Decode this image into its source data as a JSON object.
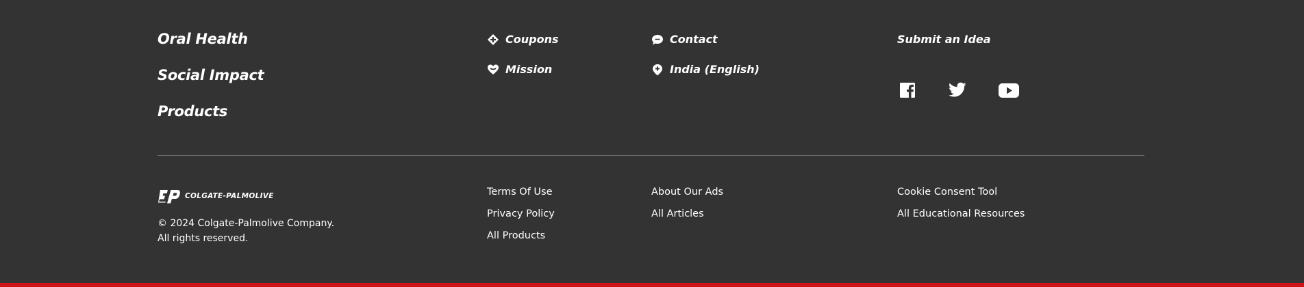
{
  "main_links": [
    "Oral Health",
    "Social Impact",
    "Products"
  ],
  "quick_links": {
    "coupons": "Coupons",
    "mission": "Mission",
    "contact": "Contact",
    "region": "India (English)"
  },
  "submit_idea": "Submit an Idea",
  "social": {
    "facebook_icon": "facebook-icon",
    "twitter_icon": "twitter-icon",
    "youtube_icon": "youtube-icon"
  },
  "brand": {
    "logo_text": "COLGATE-PALMOLIVE",
    "copyright_line1": "© 2024 Colgate-Palmolive Company.",
    "copyright_line2": "All rights reserved."
  },
  "legal_links": {
    "col1": [
      "Terms Of Use",
      "Privacy Policy",
      "All Products"
    ],
    "col2": [
      "About Our Ads",
      "All Articles"
    ],
    "col3": [
      "Cookie Consent Tool",
      "All Educational Resources"
    ]
  },
  "colors": {
    "background": "#333333",
    "accent_bar": "#d0121b",
    "text": "#ffffff"
  }
}
